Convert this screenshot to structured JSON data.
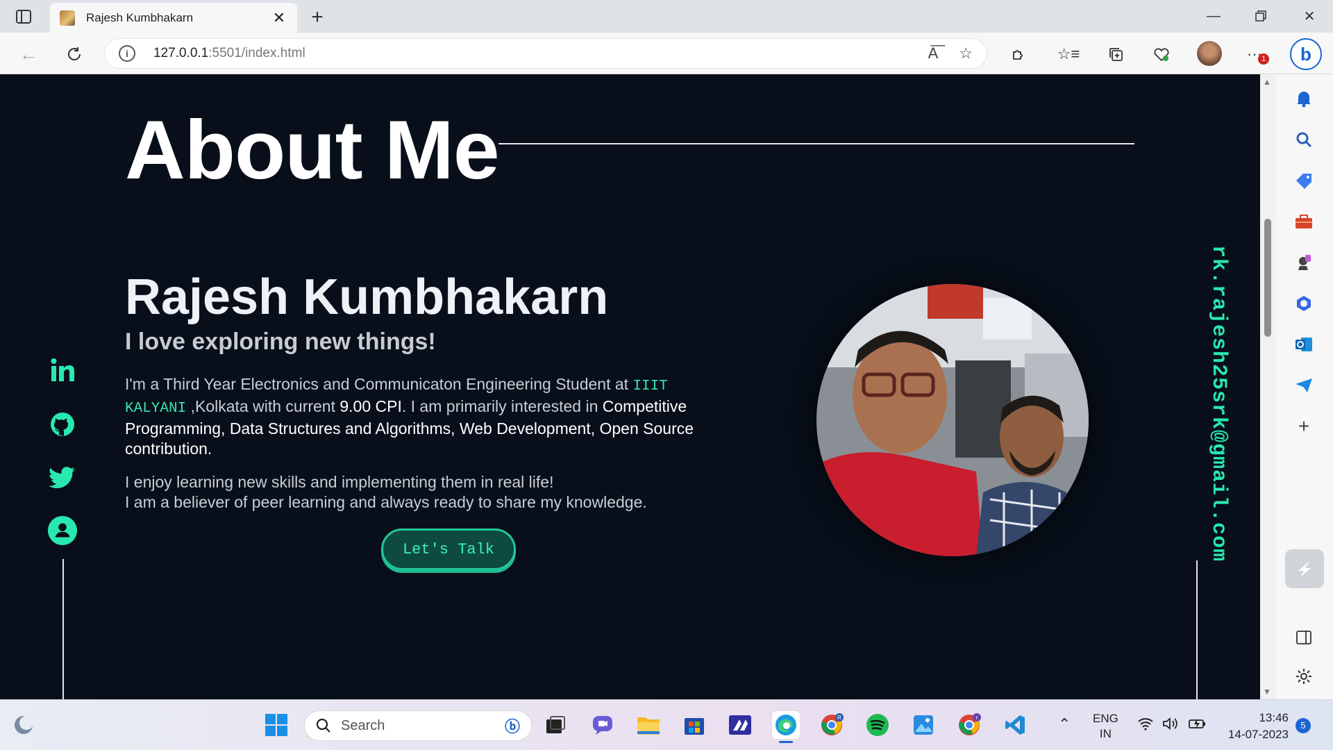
{
  "browser": {
    "tab_title": "Rajesh Kumbhakarn",
    "url_host": "127.0.0.1",
    "url_path": ":5501/index.html",
    "menu_badge": "1"
  },
  "page": {
    "section_title": "About Me",
    "name": "Rajesh Kumbhakarn",
    "tagline": "I love exploring new things!",
    "para1": {
      "t1": "I'm a Third Year Electronics and Communicaton Engineering Student at ",
      "college": "IIIT KALYANI",
      "t2": " ,Kolkata with current ",
      "cpi": "9.00 CPI",
      "t3": ". I am primarily interested in ",
      "interests": "Competitive Programming, Data Structures and Algorithms, Web Development, Open Source contribution."
    },
    "para2_line1": "I enjoy learning new skills and implementing them in real life!",
    "para2_line2": "I am a believer of peer learning and always ready to share my knowledge.",
    "cta_label": "Let's Talk",
    "email": "rk.rajesh25srk@gmail.com",
    "accent_color": "#28e8b0",
    "background_color": "#080f1a",
    "social_icons": [
      "linkedin-icon",
      "github-icon",
      "twitter-icon",
      "profile-icon"
    ]
  },
  "taskbar": {
    "search_placeholder": "Search",
    "lang_line1": "ENG",
    "lang_line2": "IN",
    "time": "13:46",
    "date": "14-07-2023",
    "notification_count": "5"
  }
}
